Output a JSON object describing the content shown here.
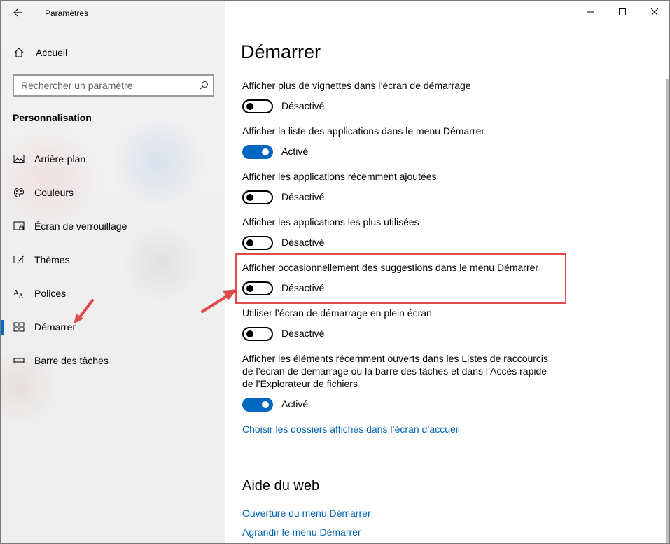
{
  "window": {
    "title": "Paramètres"
  },
  "sidebar": {
    "home_label": "Accueil",
    "search_placeholder": "Rechercher un paramètre",
    "section_title": "Personnalisation",
    "items": [
      {
        "label": "Arrière-plan",
        "icon": "image-icon"
      },
      {
        "label": "Couleurs",
        "icon": "palette-icon"
      },
      {
        "label": "Écran de verrouillage",
        "icon": "lock-screen-icon"
      },
      {
        "label": "Thèmes",
        "icon": "theme-brush-icon"
      },
      {
        "label": "Polices",
        "icon": "font-icon"
      },
      {
        "label": "Démarrer",
        "icon": "start-grid-icon",
        "active": true
      },
      {
        "label": "Barre des tâches",
        "icon": "taskbar-icon"
      }
    ]
  },
  "main": {
    "title": "Démarrer",
    "settings": [
      {
        "description": "Afficher plus de vignettes dans l’écran de démarrage",
        "state": "Désactivé",
        "on": false
      },
      {
        "description": "Afficher la liste des applications dans le menu Démarrer",
        "state": "Activé",
        "on": true
      },
      {
        "description": "Afficher les applications récemment ajoutées",
        "state": "Désactivé",
        "on": false
      },
      {
        "description": "Afficher les applications les plus utilisées",
        "state": "Désactivé",
        "on": false
      },
      {
        "description": "Afficher occasionnellement des suggestions dans le menu Démarrer",
        "state": "Désactivé",
        "on": false
      },
      {
        "description": "Utiliser l’écran de démarrage en plein écran",
        "state": "Désactivé",
        "on": false
      },
      {
        "description": "Afficher les éléments récemment ouverts dans les Listes de raccourcis de l’écran de démarrage ou la barre des tâches et dans l’Accès rapide de l’Explorateur de fichiers",
        "state": "Activé",
        "on": true
      }
    ],
    "folders_link": "Choisir les dossiers affichés dans l’écran d’accueil",
    "web_help": {
      "title": "Aide du web",
      "links": [
        "Ouverture du menu Démarrer",
        "Agrandir le menu Démarrer"
      ]
    }
  },
  "colors": {
    "accent": "#0067c0",
    "link": "#0063b1",
    "annotation": "#e04a4a"
  }
}
